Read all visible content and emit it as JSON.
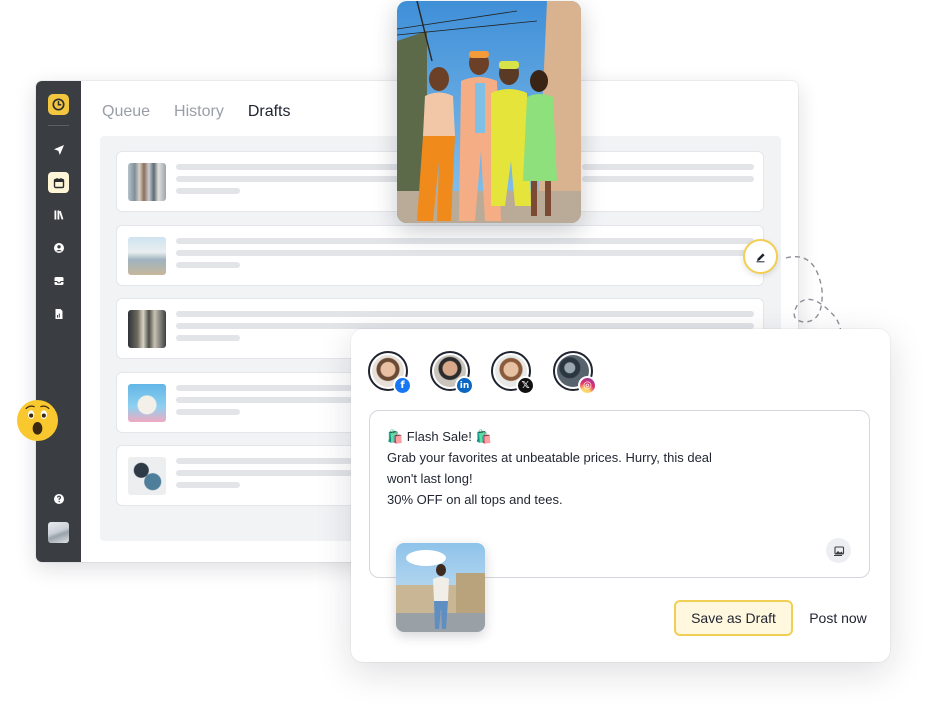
{
  "tabs": [
    {
      "label": "Queue",
      "active": false
    },
    {
      "label": "History",
      "active": false
    },
    {
      "label": "Drafts",
      "active": true
    }
  ],
  "sidebar": {
    "items": [
      {
        "name": "publish",
        "icon": "send-icon",
        "active": false
      },
      {
        "name": "calendar",
        "icon": "calendar-icon",
        "active": true
      },
      {
        "name": "library",
        "icon": "library-icon",
        "active": false
      },
      {
        "name": "profile",
        "icon": "user-circle-icon",
        "active": false
      },
      {
        "name": "inbox",
        "icon": "inbox-icon",
        "active": false
      },
      {
        "name": "reports",
        "icon": "report-icon",
        "active": false
      }
    ],
    "help_icon": "help-icon"
  },
  "draft_rows": [
    {
      "thumb": "clothing-rack"
    },
    {
      "thumb": "man-in-hat"
    },
    {
      "thumb": "three-men"
    },
    {
      "thumb": "man-sky-blue"
    },
    {
      "thumb": "outfit-flatlay"
    }
  ],
  "compose": {
    "accounts": [
      {
        "network": "facebook",
        "badge_text": "f",
        "badge_color": "#1877f2"
      },
      {
        "network": "linkedin",
        "badge_text": "in",
        "badge_color": "#0a66c2"
      },
      {
        "network": "x",
        "badge_text": "𝕏",
        "badge_color": "#111111"
      },
      {
        "network": "instagram",
        "badge_text": "◎",
        "badge_color": "#e1306c"
      }
    ],
    "post_lines": [
      "🛍️ Flash Sale! 🛍️",
      "Grab your favorites at unbeatable prices. Hurry, this deal",
      "won't last long!",
      "30% OFF on all tops and tees."
    ],
    "save_draft_label": "Save as Draft",
    "post_now_label": "Post now"
  },
  "colors": {
    "accent": "#f3c63f",
    "sidebar": "#3a3e42"
  }
}
